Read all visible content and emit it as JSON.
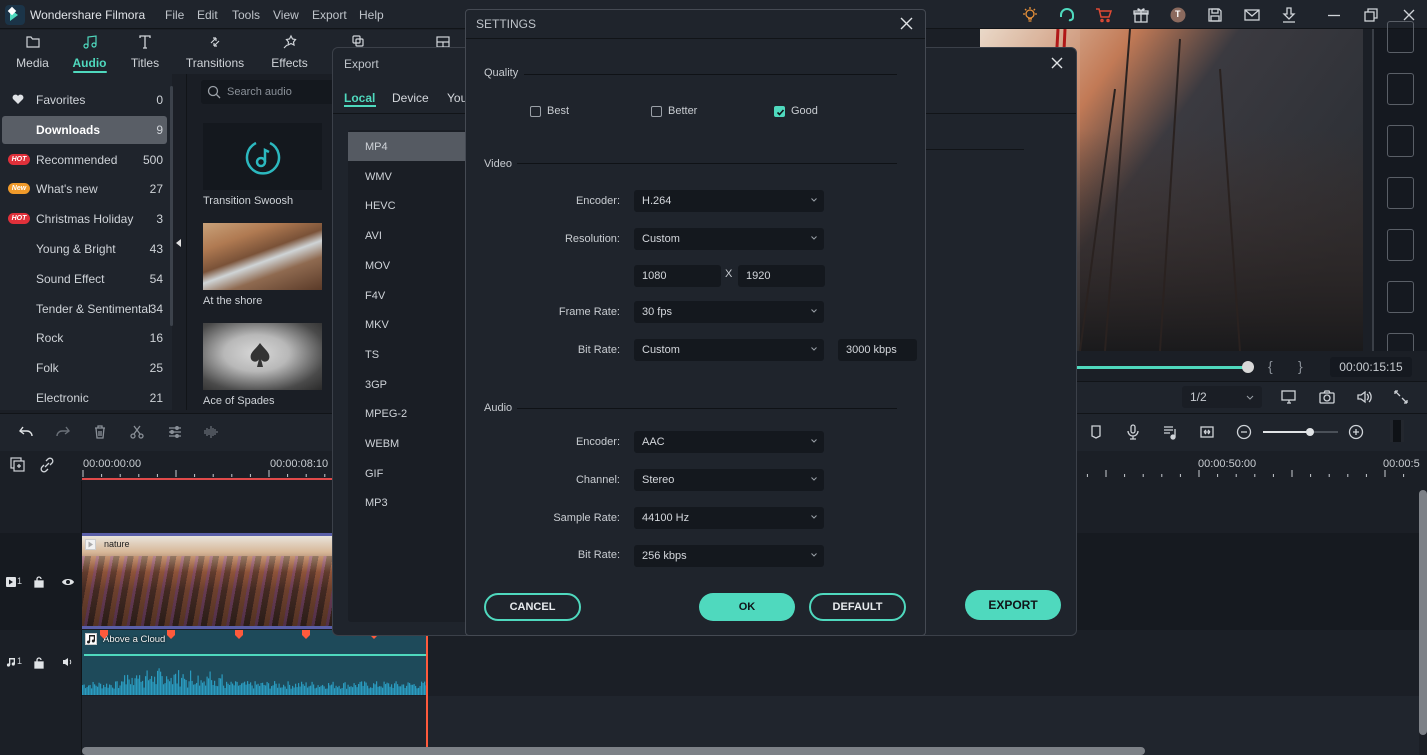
{
  "app": {
    "title": "Wondershare Filmora",
    "menu": [
      "File",
      "Edit",
      "Tools",
      "View",
      "Export",
      "Help"
    ],
    "avatar_initial": "T",
    "accent_color": "#4fd9be"
  },
  "top_tabs": [
    {
      "label": "Media",
      "icon": "folder-icon",
      "active": false
    },
    {
      "label": "Audio",
      "icon": "music-note-icon",
      "active": true
    },
    {
      "label": "Titles",
      "icon": "text-icon",
      "active": false
    },
    {
      "label": "Transitions",
      "icon": "transitions-icon",
      "active": false
    },
    {
      "label": "Effects",
      "icon": "effects-icon",
      "active": false
    }
  ],
  "sidebar": {
    "items": [
      {
        "label": "Favorites",
        "count": "0",
        "badge": "heart"
      },
      {
        "label": "Downloads",
        "count": "9",
        "badge": "",
        "selected": true
      },
      {
        "label": "Recommended",
        "count": "500",
        "badge": "HOT"
      },
      {
        "label": "What's new",
        "count": "27",
        "badge": "New"
      },
      {
        "label": "Christmas Holiday",
        "count": "3",
        "badge": "HOT"
      },
      {
        "label": "Young & Bright",
        "count": "43",
        "badge": ""
      },
      {
        "label": "Sound Effect",
        "count": "54",
        "badge": ""
      },
      {
        "label": "Tender & Sentimental",
        "count": "34",
        "badge": ""
      },
      {
        "label": "Rock",
        "count": "16",
        "badge": ""
      },
      {
        "label": "Folk",
        "count": "25",
        "badge": ""
      },
      {
        "label": "Electronic",
        "count": "21",
        "badge": ""
      }
    ]
  },
  "library": {
    "search_placeholder": "Search audio",
    "items": [
      {
        "caption": "Transition Swoosh"
      },
      {
        "caption": "At the shore"
      },
      {
        "caption": "Ace of Spades"
      }
    ]
  },
  "preview": {
    "timecode": "00:00:15:15",
    "zoom": "1/2",
    "progress_percent": 97
  },
  "timeline": {
    "ruler_labels": [
      "00:00:00:00",
      "00:00:08:10",
      "00:00:50:00",
      "00:00:5"
    ],
    "video_track_label": "1",
    "audio_track_label": "1",
    "video_clip_name": "nature",
    "audio_clip_name": "Above a Cloud",
    "zoom_slider_percent": 62
  },
  "export_dialog": {
    "title": "Export",
    "tabs": [
      {
        "label": "Local",
        "active": true
      },
      {
        "label": "Device",
        "active": false
      },
      {
        "label": "You",
        "active": false
      }
    ],
    "formats": [
      "MP4",
      "WMV",
      "HEVC",
      "AVI",
      "MOV",
      "F4V",
      "MKV",
      "TS",
      "3GP",
      "MPEG-2",
      "WEBM",
      "GIF",
      "MP3"
    ],
    "selected_format": "MP4",
    "export_label": "EXPORT"
  },
  "settings": {
    "title": "SETTINGS",
    "quality": {
      "label": "Quality",
      "options": [
        {
          "label": "Best",
          "checked": false
        },
        {
          "label": "Better",
          "checked": false
        },
        {
          "label": "Good",
          "checked": true
        }
      ]
    },
    "video": {
      "label": "Video",
      "encoder_label": "Encoder:",
      "encoder": "H.264",
      "resolution_label": "Resolution:",
      "resolution": "Custom",
      "width": "1080",
      "x_sep": "X",
      "height": "1920",
      "frame_rate_label": "Frame Rate:",
      "frame_rate": "30 fps",
      "bit_rate_label": "Bit Rate:",
      "bit_rate": "Custom",
      "bit_rate_value": "3000 kbps"
    },
    "audio": {
      "label": "Audio",
      "encoder_label": "Encoder:",
      "encoder": "AAC",
      "channel_label": "Channel:",
      "channel": "Stereo",
      "sample_rate_label": "Sample Rate:",
      "sample_rate": "44100 Hz",
      "bit_rate_label": "Bit Rate:",
      "bit_rate": "256 kbps"
    },
    "buttons": {
      "cancel": "CANCEL",
      "ok": "OK",
      "default": "DEFAULT"
    }
  }
}
